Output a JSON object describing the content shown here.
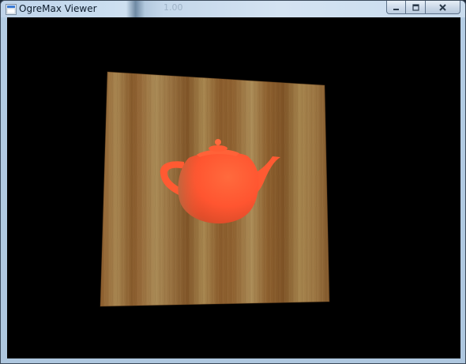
{
  "window": {
    "title": "OgreMax Viewer",
    "icon": "ogremax-app-icon"
  },
  "background_window": {
    "ghost_text": "1.00"
  },
  "caption_buttons": {
    "minimize_icon": "minimize-icon",
    "maximize_icon": "maximize-icon",
    "close_icon": "close-icon"
  },
  "scene": {
    "background_color": "#000000",
    "plane_texture": "wood-planks",
    "plane_colors": [
      "#8a5b2c",
      "#a8884f",
      "#7f5628"
    ],
    "teapot_color": "#ff5a32"
  }
}
